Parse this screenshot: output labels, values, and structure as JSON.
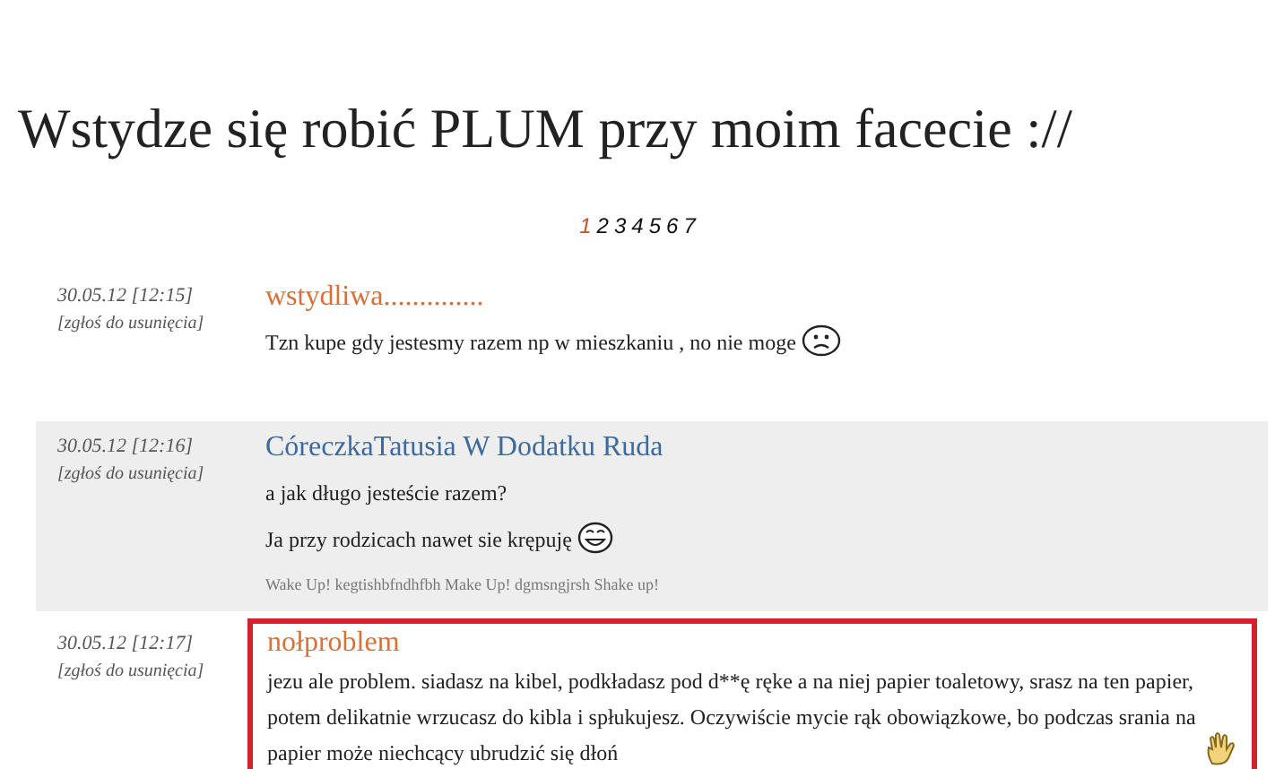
{
  "title": "Wstydze się robić PLUM przy moim facecie ://",
  "pages": [
    {
      "label": "1",
      "selected": true
    },
    {
      "label": "2",
      "selected": false
    },
    {
      "label": "3",
      "selected": false
    },
    {
      "label": "4",
      "selected": false
    },
    {
      "label": "5",
      "selected": false
    },
    {
      "label": "6",
      "selected": false
    },
    {
      "label": "7",
      "selected": false
    }
  ],
  "posts": [
    {
      "date": "30.05.12 [12:15]",
      "report": "[zgłoś do usunięcia]",
      "author": "wstydliwa..............",
      "color": "#d9703a",
      "highlighted": false,
      "framed": false,
      "lines": [
        {
          "text": "Tzn kupe gdy jestesmy razem np w mieszkaniu , no nie moge",
          "kind": "sad"
        }
      ]
    },
    {
      "date": "30.05.12 [12:16]",
      "report": "[zgłoś do usunięcia]",
      "author": "CóreczkaTatusia W Dodatku Ruda",
      "color": "#3d6a9e",
      "highlighted": true,
      "framed": false,
      "lines": [
        {
          "text": "a jak długo jesteście razem?"
        },
        {
          "text": "Ja przy rodzicach nawet sie krępuję",
          "kind": "grin"
        }
      ],
      "signature": "Wake Up! kegtishbfndhfbh Make Up! dgmsngjrsh Shake up!"
    },
    {
      "date": "30.05.12 [12:17]",
      "report": "[zgłoś do usunięcia]",
      "author": "nołproblem",
      "color": "#d9703a",
      "highlighted": false,
      "framed": true,
      "lines": [
        {
          "text": "jezu ale problem. siadasz na kibel, podkładasz pod d**ę ręke a na niej papier toaletowy, srasz na ten papier, potem delikatnie wrzucasz do kibla i spłukujesz. Oczywiście mycie rąk obowiązkowe, bo podczas srania na papier może niechcący ubrudzić się dłoń",
          "kind": "hand"
        }
      ]
    }
  ]
}
